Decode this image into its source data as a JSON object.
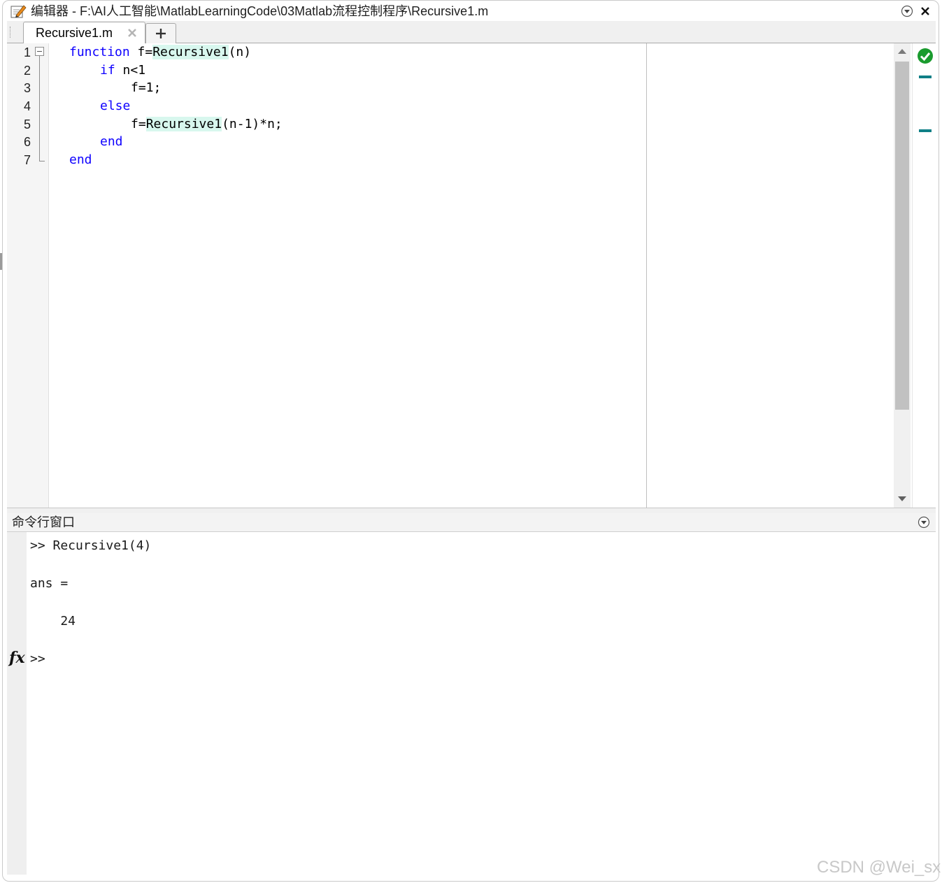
{
  "window": {
    "title": "编辑器 - F:\\AI人工智能\\MatlabLearningCode\\03Matlab流程控制程序\\Recursive1.m"
  },
  "tabs": [
    {
      "label": "Recursive1.m"
    }
  ],
  "editor": {
    "line_numbers": [
      "1",
      "2",
      "3",
      "4",
      "5",
      "6",
      "7"
    ],
    "lines": [
      {
        "k1": "function",
        "t1": " f=",
        "h1": "Recursive1",
        "t2": "(n)"
      },
      {
        "k1": "if",
        "t1": " n<1"
      },
      {
        "t1": "f=1;"
      },
      {
        "k1": "else"
      },
      {
        "t1": "f=",
        "h1": "Recursive1",
        "t2": "(n-1)*n;"
      },
      {
        "k1": "end"
      },
      {
        "k1": "end"
      }
    ],
    "status": "no-issues-check"
  },
  "command_window": {
    "title": "命令行窗口",
    "lines": [
      ">> Recursive1(4)",
      "ans =",
      "    24"
    ],
    "prompt": ">>",
    "fx_label": "fx"
  },
  "watermark": "CSDN @Wei_sx",
  "colors": {
    "keyword": "#0e00ff",
    "highlight": "#d8f7ee",
    "status_ok": "#1a9b2e",
    "marker": "#0f7f86"
  }
}
